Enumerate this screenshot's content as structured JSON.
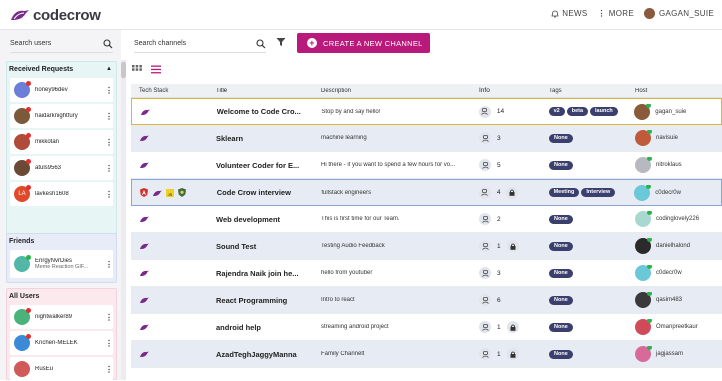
{
  "brand": {
    "name": "codecrow"
  },
  "nav": {
    "news": "NEWS",
    "more": "MORE",
    "user": "GAGAN_SUIE"
  },
  "left": {
    "search_placeholder": "Search users",
    "received": {
      "title": "Received Requests",
      "items": [
        {
          "name": "honey96dev",
          "color": "#6b7fd8"
        },
        {
          "name": "haidarknightfury",
          "color": "#7a5a3a"
        },
        {
          "name": "mikkotan",
          "color": "#b04a3a"
        },
        {
          "name": "atuls9563",
          "color": "#6a4a34"
        },
        {
          "name": "lavkesh1608",
          "initials": "LA",
          "color": "#e04a2a"
        }
      ]
    },
    "friends": {
      "title": "Friends",
      "items": [
        {
          "name": "EnrgyNvrDies",
          "sub": "Meme Reaction GIF...",
          "color": "#53b7a8"
        }
      ]
    },
    "all": {
      "title": "All Users",
      "items": [
        {
          "name": "nightwalker89",
          "color": "#4bb37a"
        },
        {
          "name": "Krichen-MELEK",
          "color": "#3a8ad8"
        },
        {
          "name": "RusEu",
          "color": "#d05a5a"
        }
      ]
    }
  },
  "main": {
    "search_placeholder": "Search channels",
    "create_label": "CREATE A NEW CHANNEL",
    "headers": {
      "tech": "Tech Stack",
      "title": "Title",
      "desc": "Description",
      "info": "Info",
      "tags": "Tags",
      "host": "Host"
    },
    "rows": [
      {
        "title": "Welcome to Code Cro...",
        "desc": "Stop by and say hello!",
        "count": "14",
        "tags": [
          "v2",
          "beta",
          "launch"
        ],
        "host": "gagan_suie",
        "host_color": "#8a5a3c",
        "lock": false
      },
      {
        "title": "Sklearn",
        "desc": "machine learning",
        "count": "3",
        "tags": [
          "None"
        ],
        "host": "navisuie",
        "host_color": "#c05a3a",
        "lock": false
      },
      {
        "title": "Volunteer Coder for E...",
        "desc": "Hi there - if you want to spend a few hours for vo...",
        "count": "5",
        "tags": [
          "None"
        ],
        "host": "nitroklaus",
        "host_color": "#b8b8c0",
        "lock": false
      },
      {
        "title": "Code Crow interview",
        "desc": "fullstack engineers",
        "count": "4",
        "tags": [
          "Meeting",
          "Interview"
        ],
        "host": "c0decr0w",
        "host_color": "#6ac8d8",
        "lock": true
      },
      {
        "title": "Web development",
        "desc": "This is first time for our Team.",
        "count": "2",
        "tags": [
          "None"
        ],
        "host": "codinglovely226",
        "host_color": "#a8d8d0",
        "lock": false
      },
      {
        "title": "Sound Test",
        "desc": "Testing Audio Feedback",
        "count": "1",
        "tags": [
          "None"
        ],
        "host": "danielhalond",
        "host_color": "#2a2a2a",
        "lock": true
      },
      {
        "title": "Rajendra Naik join he...",
        "desc": "hello from youtuber",
        "count": "3",
        "tags": [
          "None"
        ],
        "host": "c0decr0w",
        "host_color": "#6ac8d8",
        "lock": false
      },
      {
        "title": "React Programming",
        "desc": "Intro to react",
        "count": "6",
        "tags": [
          "None"
        ],
        "host": "qasim483",
        "host_color": "#3a3a3a",
        "lock": false
      },
      {
        "title": "android help",
        "desc": "streaming android project",
        "count": "1",
        "tags": [
          "None"
        ],
        "host": "Omanpreetkaur",
        "host_color": "#d04a5a",
        "lock": true
      },
      {
        "title": "AzadTeghJaggyManna",
        "desc": "Family Channelt",
        "count": "1",
        "tags": [
          "None"
        ],
        "host": "jagjassam",
        "host_color": "#d86a9a",
        "lock": true
      }
    ]
  }
}
